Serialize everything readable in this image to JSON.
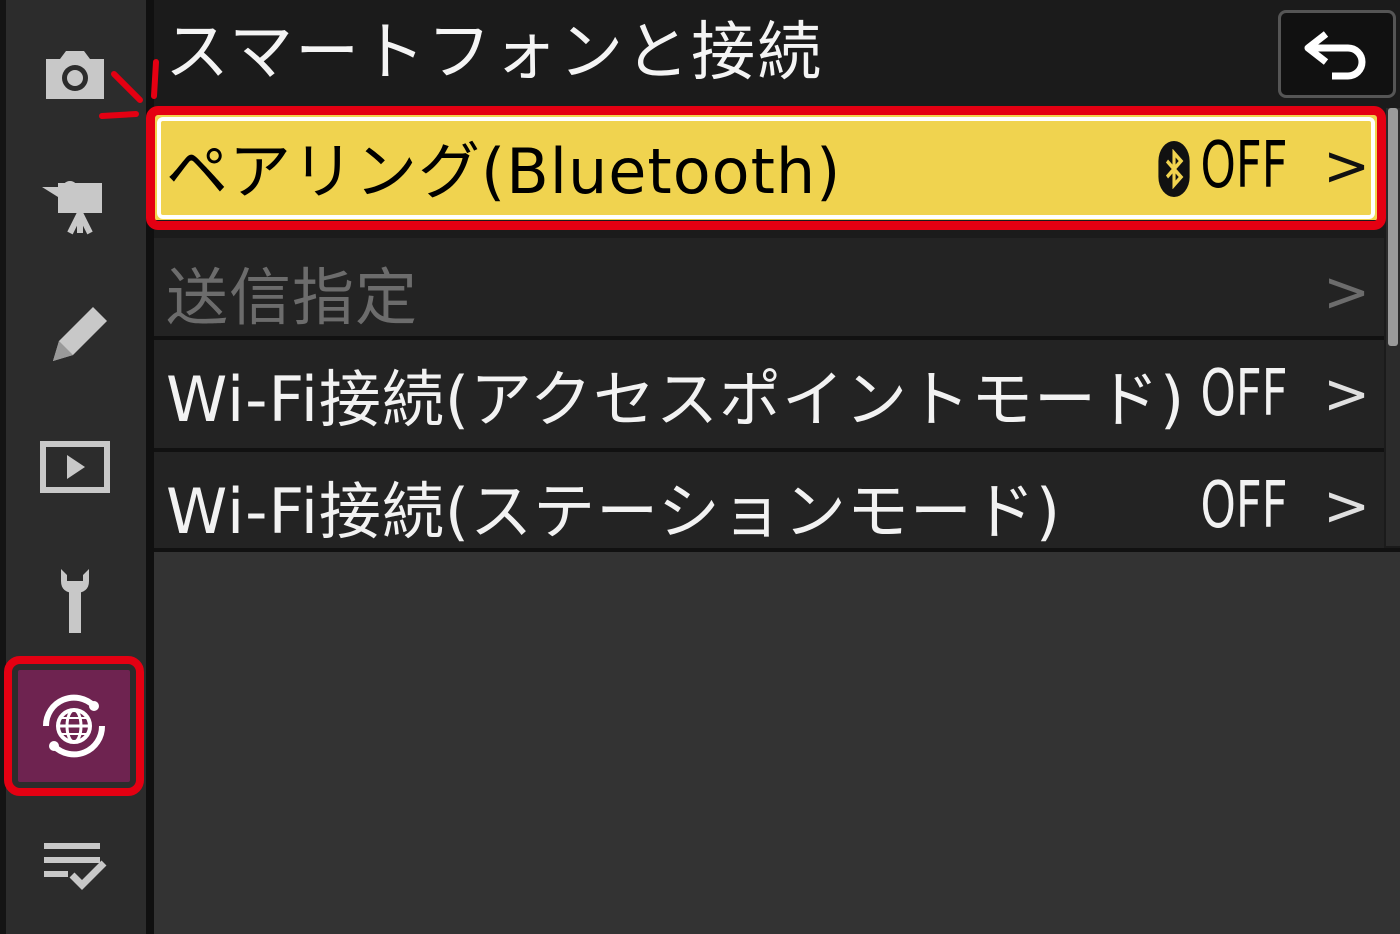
{
  "screen": {
    "title": "スマートフォンと接続",
    "back_icon": "return-arrow-icon"
  },
  "sidebar": {
    "items": [
      {
        "name": "camera",
        "icon": "camera-icon"
      },
      {
        "name": "movie",
        "icon": "movie-camera-icon"
      },
      {
        "name": "custom",
        "icon": "pencil-icon"
      },
      {
        "name": "playback",
        "icon": "play-icon"
      },
      {
        "name": "setup",
        "icon": "wrench-icon"
      },
      {
        "name": "network",
        "icon": "network-globe-icon",
        "active": true
      },
      {
        "name": "my-menu",
        "icon": "checklist-icon"
      }
    ]
  },
  "menu": {
    "items": [
      {
        "label": "ペアリング(Bluetooth)",
        "value": "OFF",
        "value_icon": "bluetooth-icon",
        "selected": true
      },
      {
        "label": "送信指定",
        "value": "",
        "disabled": true
      },
      {
        "label": "Wi-Fi接続(アクセスポイントモード)",
        "value": "OFF"
      },
      {
        "label": "Wi-Fi接続(ステーションモード)",
        "value": "OFF"
      }
    ],
    "chevron": ">"
  },
  "colors": {
    "highlight": "#f0d34f",
    "callout_red": "#e40012",
    "network_tab": "#6e2350"
  }
}
